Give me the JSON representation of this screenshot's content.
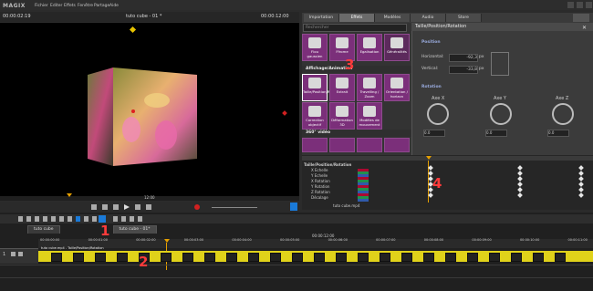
{
  "menu": {
    "logo": "MAGIX",
    "items": [
      "Fichier",
      "Editer",
      "Effets",
      "Fenêtre",
      "Partage",
      "Aide"
    ]
  },
  "preview": {
    "timecode_left": "00:00:02:19",
    "project_title": "tuto cube - 01 *",
    "timecode_right": "00:00:12:00",
    "ruler_label": "12:00"
  },
  "top_tabs": [
    "Importation",
    "Effets",
    "Modèles",
    "Audio",
    "Store"
  ],
  "effects": {
    "search_placeholder": "Rechercher",
    "section_affichage": "Affichage/Animation",
    "section_360": "360° vidéo",
    "tiles_row1": [
      "Flou gaussien",
      "Ffrome",
      "Egalisation",
      "Généralités"
    ],
    "tiles_row2": [
      "Taille/Position/Rotation",
      "Extrait",
      "Travelling / Zoom",
      "Orientation / horizon"
    ],
    "tiles_row3": [
      "Correction objectif",
      "Déformation 3D",
      "Modèles de mouvement"
    ]
  },
  "properties": {
    "header": "Taille/Position/Rotation",
    "position_title": "Position",
    "horizontal_label": "Horizontal:",
    "horizontal_value": "-92,3",
    "horizontal_unit": "px",
    "vertical_label": "Vertical:",
    "vertical_value": "-33,8",
    "vertical_unit": "px",
    "rotation_title": "Rotation",
    "axis_x": "Axe X",
    "axis_y": "Axe Y",
    "axis_z": "Axe Z",
    "val_x": "0.0",
    "val_y": "0.0",
    "val_z": "0.0"
  },
  "keyframes": {
    "header": "Taille/Position/Rotation",
    "rows": [
      "X Echelle",
      "Y Echelle",
      "X Rotation",
      "Y Rotation",
      "Z Rotation",
      "Décalage"
    ],
    "file_label": "tuto cube.mp4"
  },
  "timeline": {
    "tab1": "tuto cube",
    "tab2": "tuto cube - 01*",
    "ruler_ticks": [
      "00:00:00:00",
      "00:00:01:00",
      "00:00:02:00",
      "00:00:03:00",
      "00:00:04:00",
      "00:00:05:00",
      "00:00:06:00",
      "00:00:07:00",
      "00:00:08:00",
      "00:00:09:00",
      "00:00:10:00",
      "00:00:11:00"
    ],
    "end_time": "00:00:12:00",
    "track_number": "1",
    "clip_label": "tuto cube.mp4 - Taille/Position/Rotation"
  },
  "annotations": [
    "1",
    "2",
    "3",
    "4"
  ]
}
